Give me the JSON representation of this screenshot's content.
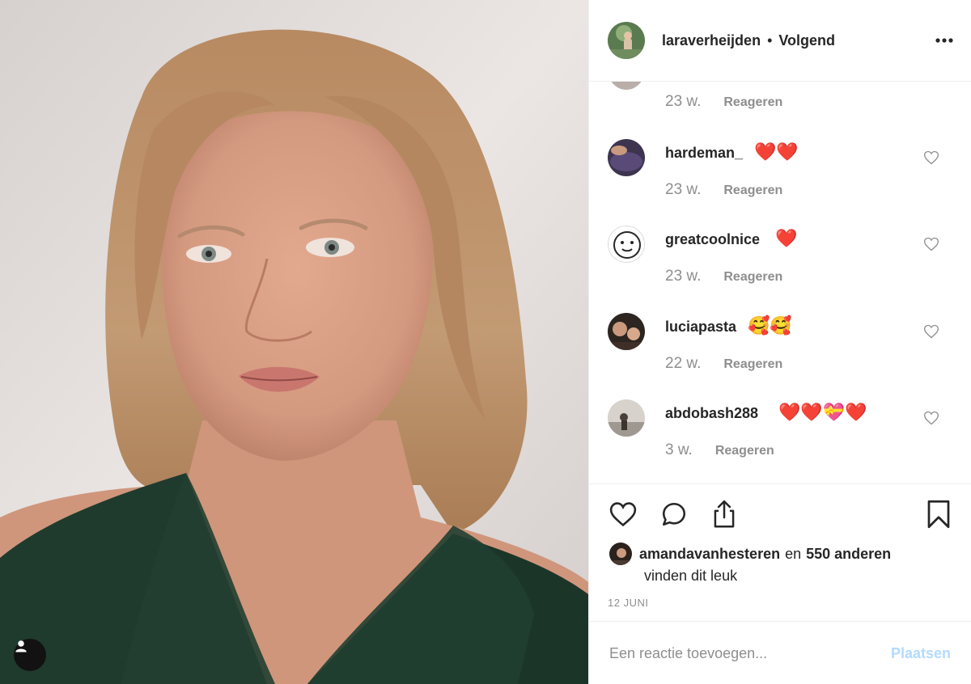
{
  "post": {
    "author": "laraverheijden",
    "separator": "•",
    "follow_label": "Volgend",
    "more_icon": "more-options-icon",
    "user_tag_icon": "user-tag-icon"
  },
  "comments_top_meta": {
    "time": "23 w.",
    "reply_label": "Reageren"
  },
  "comments": [
    {
      "username": "hardeman_",
      "emoji": "❤️❤️",
      "time": "23 w.",
      "reply_label": "Reageren"
    },
    {
      "username": "greatcoolnice",
      "emoji": "❤️",
      "time": "23 w.",
      "reply_label": "Reageren"
    },
    {
      "username": "luciapasta",
      "emoji": "🥰🥰",
      "time": "22 w.",
      "reply_label": "Reageren"
    },
    {
      "username": "abdobash288",
      "emoji": "❤️❤️💝❤️",
      "time": "3 w.",
      "reply_label": "Reageren"
    }
  ],
  "likes": {
    "liker": "amandavanhesteren",
    "conjunction": "en",
    "others": "550 anderen",
    "suffix": "vinden dit leuk"
  },
  "date": "12 JUNI",
  "comment_input": {
    "placeholder": "Een reactie toevoegen...",
    "post_label": "Plaatsen"
  },
  "colors": {
    "text": "#262626",
    "muted": "#8e8e8e",
    "divider": "#efefef",
    "post_button_disabled": "#b3dbff",
    "heart_red": "#e0245e"
  }
}
